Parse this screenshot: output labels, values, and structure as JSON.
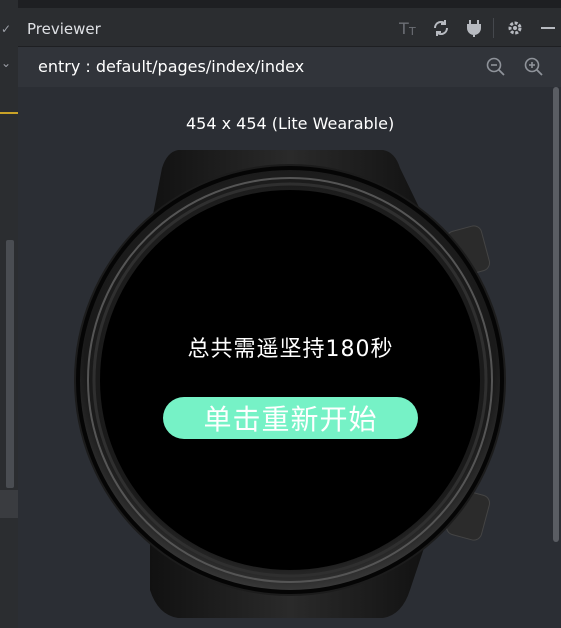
{
  "previewer": {
    "title": "Previewer",
    "toolbar_icons": [
      "text-size-icon",
      "refresh-icon",
      "plug-icon",
      "gear-icon",
      "minimize-icon"
    ]
  },
  "path_bar": {
    "path": "entry : default/pages/index/index",
    "zoom_icons": [
      "zoom-out-icon",
      "zoom-in-icon"
    ]
  },
  "device": {
    "label": "454 x 454 (Lite Wearable)"
  },
  "watch_app": {
    "message": "总共需遥坚持180秒",
    "button_label": "单击重新开始",
    "button_color": "#76f2c6"
  }
}
